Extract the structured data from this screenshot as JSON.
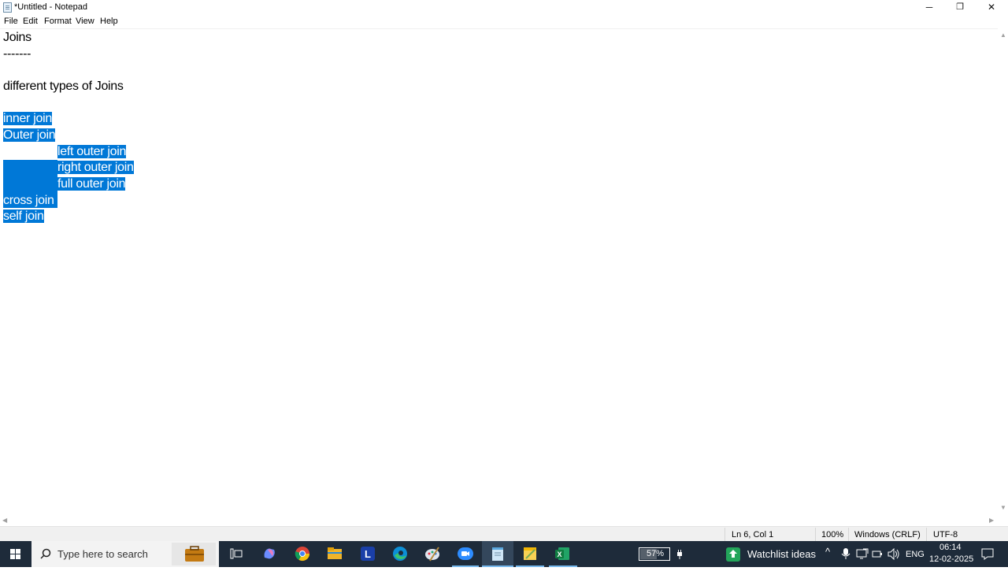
{
  "window": {
    "title": "*Untitled - Notepad",
    "minimize": "─",
    "restore": "❐",
    "close": "✕"
  },
  "menu": [
    "File",
    "Edit",
    "Format",
    "View",
    "Help"
  ],
  "editor": {
    "lines": [
      "Joins",
      "-------",
      "",
      "different types of Joins",
      ""
    ],
    "selected_lines": [
      "inner join",
      "Outer join",
      "\t\tleft outer join",
      "\t\tright outer join",
      "\t\tfull outer join",
      "cross join",
      "self join"
    ]
  },
  "status": {
    "position": "Ln 6, Col 1",
    "zoom": "100%",
    "line_ending": "Windows (CRLF)",
    "encoding": "UTF-8"
  },
  "taskbar": {
    "search_placeholder": "Type here to search",
    "apps": [
      "briefcase-icon",
      "task-view-icon",
      "copilot-icon",
      "chrome-icon",
      "file-explorer-icon",
      "l-app-icon",
      "edge-icon",
      "paint-icon",
      "zoom-icon",
      "notepad-icon",
      "sticky-notes-icon",
      "excel-icon"
    ],
    "battery": "57%",
    "widget": "Watchlist ideas",
    "language": "ENG",
    "time": "06:14",
    "date": "12-02-2025",
    "colors": {
      "taskbar": "#1e2b3a",
      "selection": "#0078d7",
      "accent": "#76b9ed"
    }
  }
}
